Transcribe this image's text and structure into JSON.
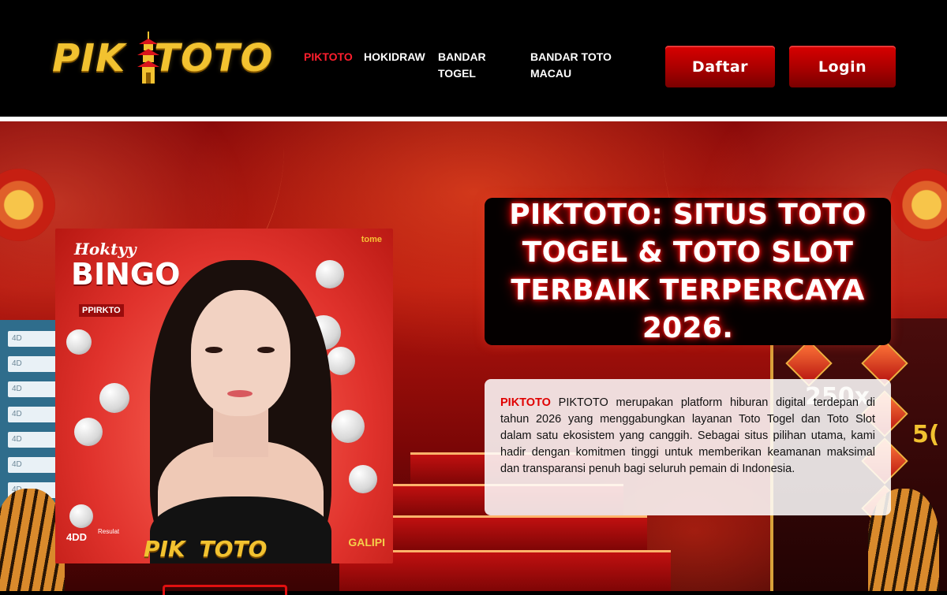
{
  "header": {
    "logo_text_left": "PIK",
    "logo_text_right": "TOTO",
    "nav": [
      {
        "label": "PIKTOTO",
        "active": true
      },
      {
        "label": "HOKIDRAW",
        "active": false
      },
      {
        "label": "BANDAR TOGEL",
        "active": false
      },
      {
        "label": "BANDAR TOTO MACAU",
        "active": false
      }
    ],
    "buttons": {
      "register": "Daftar",
      "login": "Login"
    }
  },
  "hero": {
    "title": "PIKTOTO: SITUS TOTO TOGEL & TOTO SLOT TERBAIK TERPERCAYA 2026.",
    "description_highlight": "PIKTOTO",
    "description": "PIKTOTO merupakan platform hiburan digital terdepan di tahun 2026 yang menggabungkan layanan Toto Togel dan Toto Slot dalam satu ekosistem yang canggih. Sebagai situs pilihan utama, kami hadir dengan komitmen tinggi untuk memberikan keamanan maksimal dan transparansi penuh bagi seluruh pemain di Indonesia.",
    "banner": {
      "small_title": "Hoktyy",
      "big_title": "BINGO",
      "sub_label": "PPIRKTO",
      "brand_top": "tome",
      "logo_left": "PIK",
      "logo_right": "TOTO",
      "four_dd": "4DD",
      "result_label": "Resulat",
      "corner_mark": "GALIPI"
    },
    "side_chips": [
      "4D",
      "4D",
      "4D",
      "4D",
      "4D",
      "4D",
      "4D"
    ],
    "slot_multiplier": "250x",
    "slot_multiplier_2": "5("
  },
  "colors": {
    "accent_red": "#e00000",
    "gold": "#f2c230",
    "nav_active": "#ff1e2d"
  },
  "icons": [
    "pagoda-icon"
  ]
}
